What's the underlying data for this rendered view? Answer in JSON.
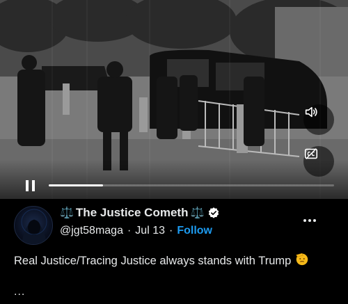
{
  "video": {
    "progress_fraction": 0.19,
    "icons": {
      "pause": "pause-icon",
      "volume": "volume-icon",
      "captions": "closed-captions-icon"
    }
  },
  "tweet": {
    "display_name": "The Justice Cometh",
    "name_emoji": "⚖️",
    "handle": "@jgt58maga",
    "separator": "·",
    "date": "Jul 13",
    "follow_label": "Follow",
    "text": "Real Justice/Tracing Justice always stands with Trump",
    "trailing": "..."
  },
  "colors": {
    "background": "#000000",
    "text": "#e7e9ea",
    "follow": "#1d9bf0",
    "verified_badge": "#ffffff"
  }
}
